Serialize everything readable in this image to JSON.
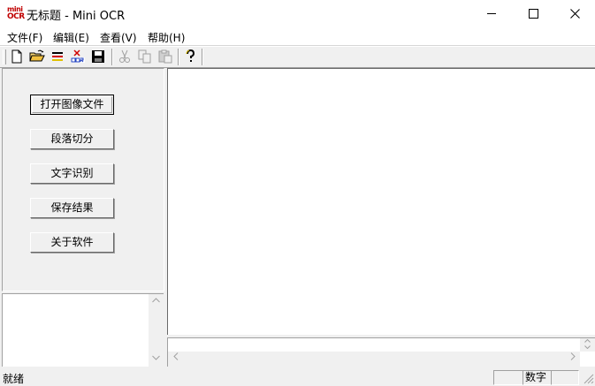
{
  "window": {
    "title": "无标题 - Mini OCR",
    "icon_top": "mini",
    "icon_bottom": "OCR",
    "controls": [
      "minimize-icon",
      "maximize-icon",
      "close-icon"
    ]
  },
  "menu": {
    "items": [
      {
        "label": "文件(F)"
      },
      {
        "label": "编辑(E)"
      },
      {
        "label": "查看(V)"
      },
      {
        "label": "帮助(H)"
      }
    ]
  },
  "toolbar": {
    "buttons": [
      {
        "icon": "new-document-icon",
        "enabled": true
      },
      {
        "icon": "open-folder-icon",
        "enabled": true
      },
      {
        "icon": "segment-icon",
        "enabled": true
      },
      {
        "icon": "ocr-icon",
        "enabled": true
      },
      {
        "icon": "save-icon",
        "enabled": true
      },
      {
        "icon": "cut-icon",
        "enabled": false
      },
      {
        "icon": "copy-icon",
        "enabled": false
      },
      {
        "icon": "paste-icon",
        "enabled": false
      },
      {
        "icon": "help-icon",
        "enabled": true
      }
    ]
  },
  "side_panel": {
    "buttons": [
      {
        "label": "打开图像文件"
      },
      {
        "label": "段落切分"
      },
      {
        "label": "文字识别"
      },
      {
        "label": "保存结果"
      },
      {
        "label": "关于软件"
      }
    ]
  },
  "status_bar": {
    "text": "就绪",
    "panes": [
      "",
      "数字",
      ""
    ]
  },
  "colors": {
    "face": "#f0f0f0",
    "shadow": "#a0a0a0",
    "dark_shadow": "#696969",
    "highlight": "#ffffff",
    "ocr_red": "#c00000"
  }
}
